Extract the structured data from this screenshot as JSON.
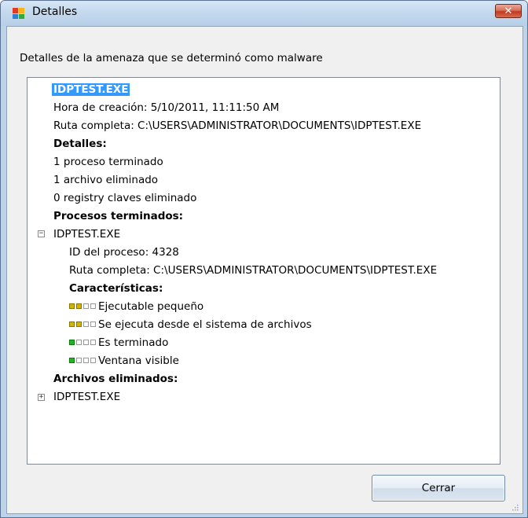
{
  "window": {
    "title": "Detalles",
    "close_icon": "close-icon"
  },
  "description": "Detalles de la amenaza que se determinó como malware",
  "details": {
    "file_name": "IDPTEST.EXE",
    "creation_time": "Hora de creación: 5/10/2011, 11:11:50 AM",
    "full_path": "Ruta completa: C:\\USERS\\ADMINISTRATOR\\DOCUMENTS\\IDPTEST.EXE",
    "details_header": "Detalles:",
    "summary": [
      "1 proceso terminado",
      "1 archivo eliminado",
      "0 registry claves eliminado"
    ],
    "processes_header": "Procesos terminados:",
    "process": {
      "name": "IDPTEST.EXE",
      "expanded": true,
      "id_line": "ID del proceso: 4328",
      "path_line": "Ruta completa: C:\\USERS\\ADMINISTRATOR\\DOCUMENTS\\IDPTEST.EXE",
      "characteristics_header": "Características:",
      "characteristics": [
        {
          "label": "Ejecutable pequeño",
          "level": 2,
          "color": "#d4b400"
        },
        {
          "label": "Se ejecuta desde el sistema de archivos",
          "level": 2,
          "color": "#d4b400"
        },
        {
          "label": "Es terminado",
          "level": 1,
          "color": "#22b422"
        },
        {
          "label": "Ventana visible",
          "level": 1,
          "color": "#22b422"
        }
      ]
    },
    "files_header": "Archivos eliminados:",
    "deleted_file": {
      "name": "IDPTEST.EXE",
      "expanded": false
    }
  },
  "buttons": {
    "close_label": "Cerrar"
  }
}
